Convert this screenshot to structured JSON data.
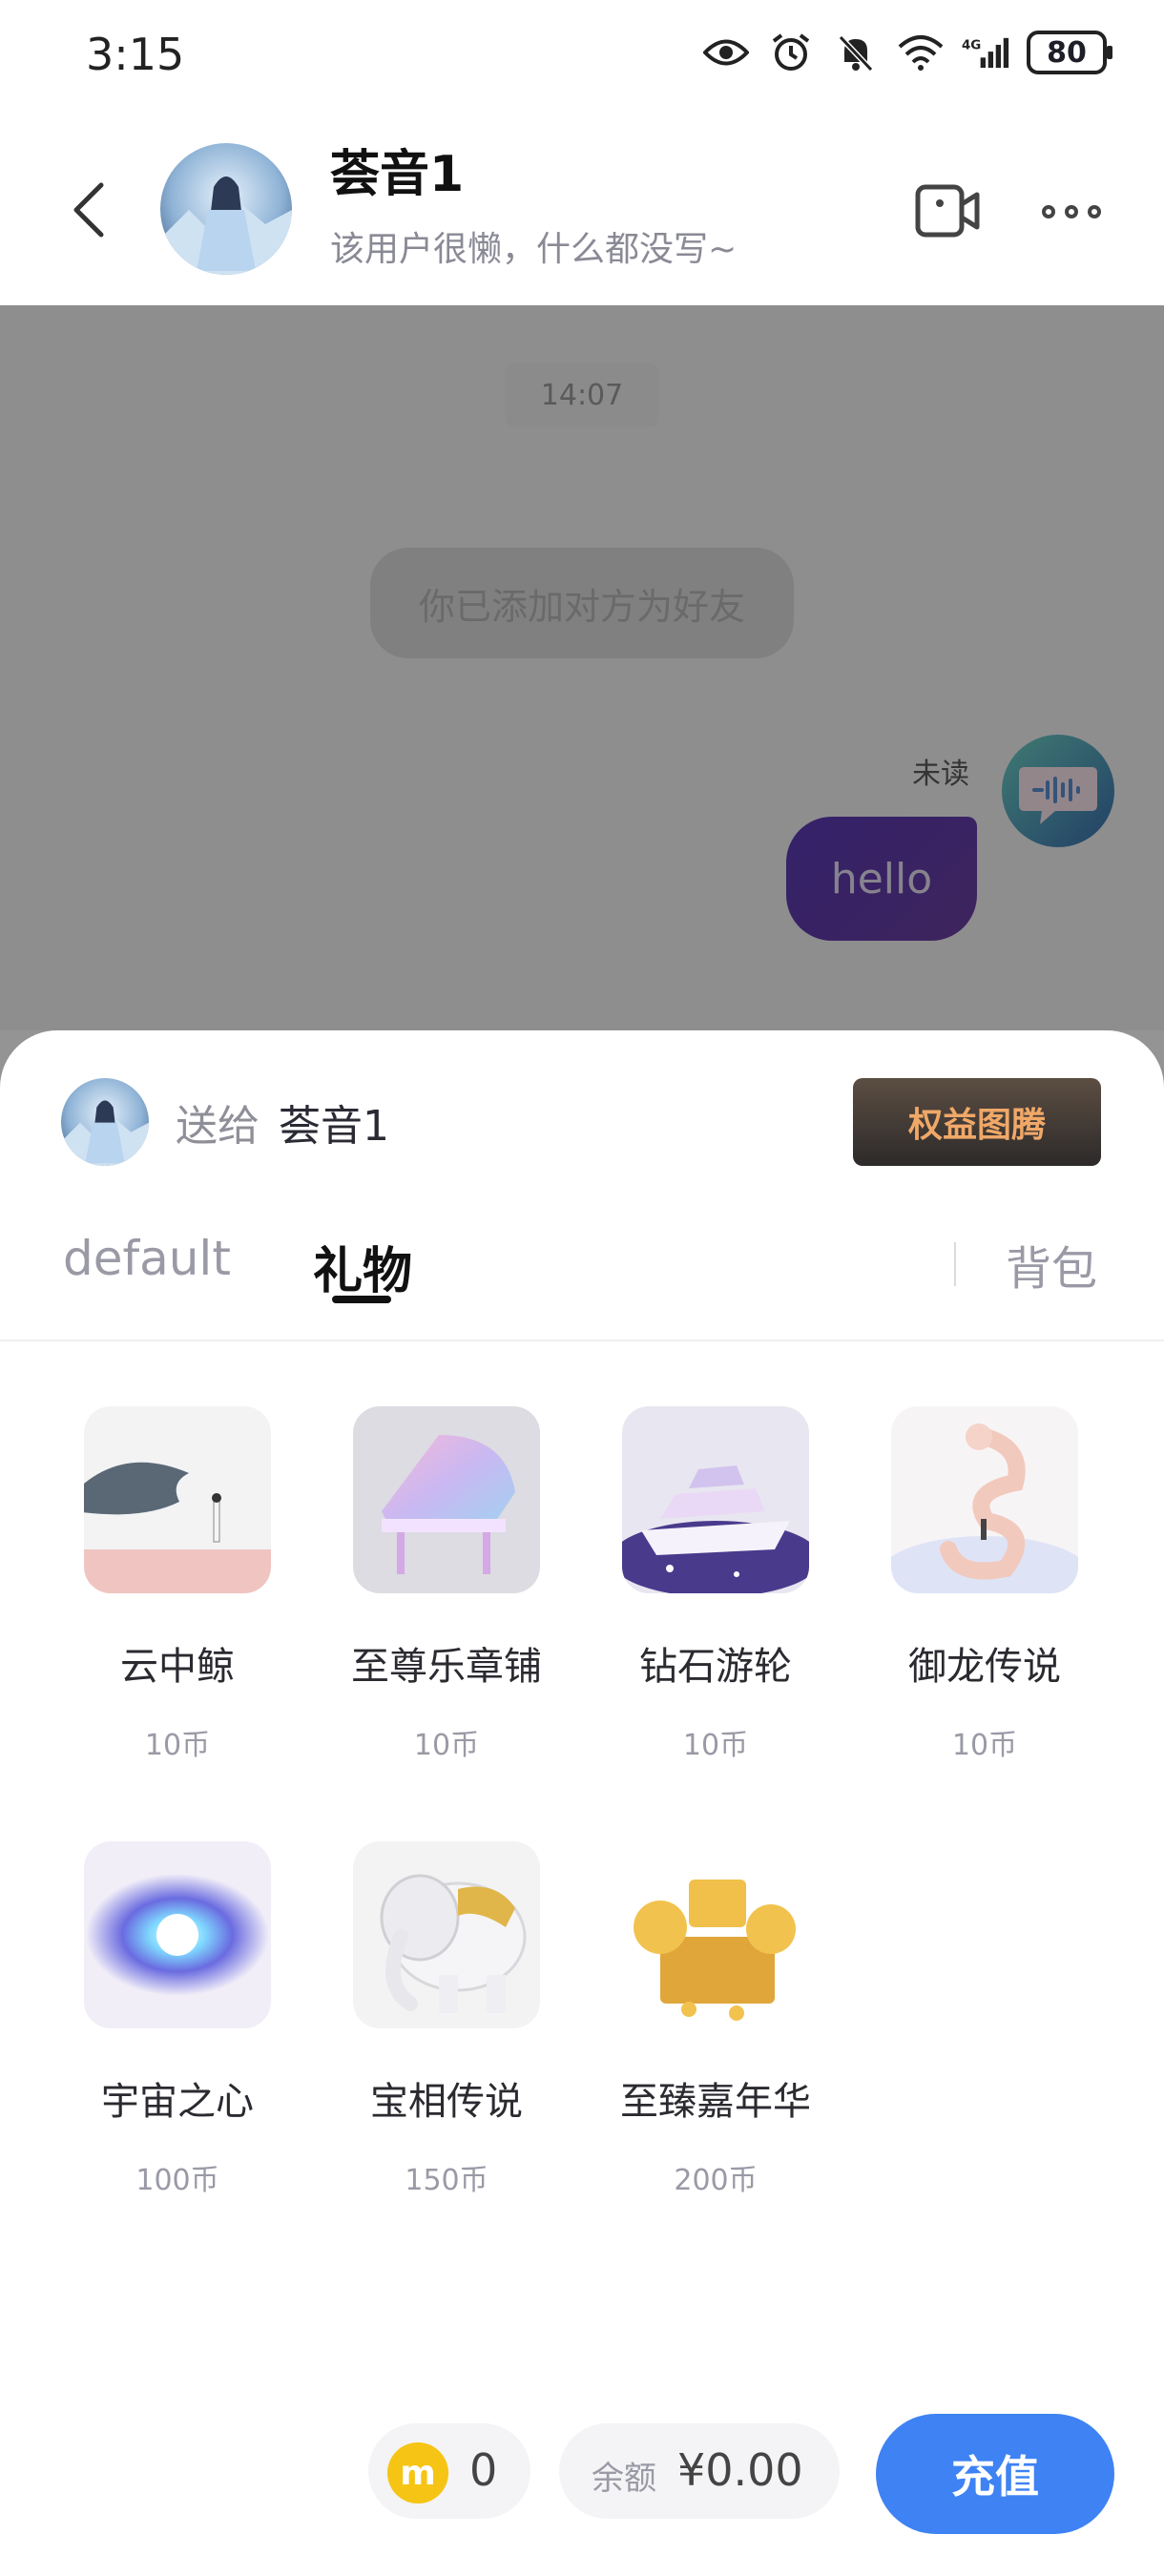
{
  "status_bar": {
    "time": "3:15",
    "battery": "80",
    "icons": [
      "eye-icon",
      "alarm-icon",
      "bell-off-icon",
      "wifi-icon",
      "signal-4g-icon"
    ]
  },
  "header": {
    "name": "荟音1",
    "signature": "该用户很懒，什么都没写~"
  },
  "chat": {
    "timestamp": "14:07",
    "system_message": "你已添加对方为好友",
    "unread_label": "未读",
    "messages": [
      {
        "text": "hello",
        "side": "right"
      }
    ]
  },
  "gift_sheet": {
    "send_to_label": "送给",
    "send_to_name": "荟音1",
    "rights_button": "权益图腾",
    "tabs": {
      "default": "default",
      "gift": "礼物",
      "backpack": "背包"
    },
    "gifts": [
      {
        "name": "云中鲸",
        "price": "10币"
      },
      {
        "name": "至尊乐章铺",
        "price": "10币"
      },
      {
        "name": "钻石游轮",
        "price": "10币"
      },
      {
        "name": "御龙传说",
        "price": "10币"
      },
      {
        "name": "宇宙之心",
        "price": "100币"
      },
      {
        "name": "宝相传说",
        "price": "150币"
      },
      {
        "name": "至臻嘉年华",
        "price": "200币"
      }
    ]
  },
  "wallet": {
    "coin_symbol": "m",
    "coins": "0",
    "balance_label": "余额",
    "balance": "¥0.00",
    "recharge": "充值"
  },
  "colors": {
    "accent": "#3e82f3",
    "bubble": "#5a3ab6",
    "coin": "#f6c414",
    "rights_text": "#f0a868"
  }
}
